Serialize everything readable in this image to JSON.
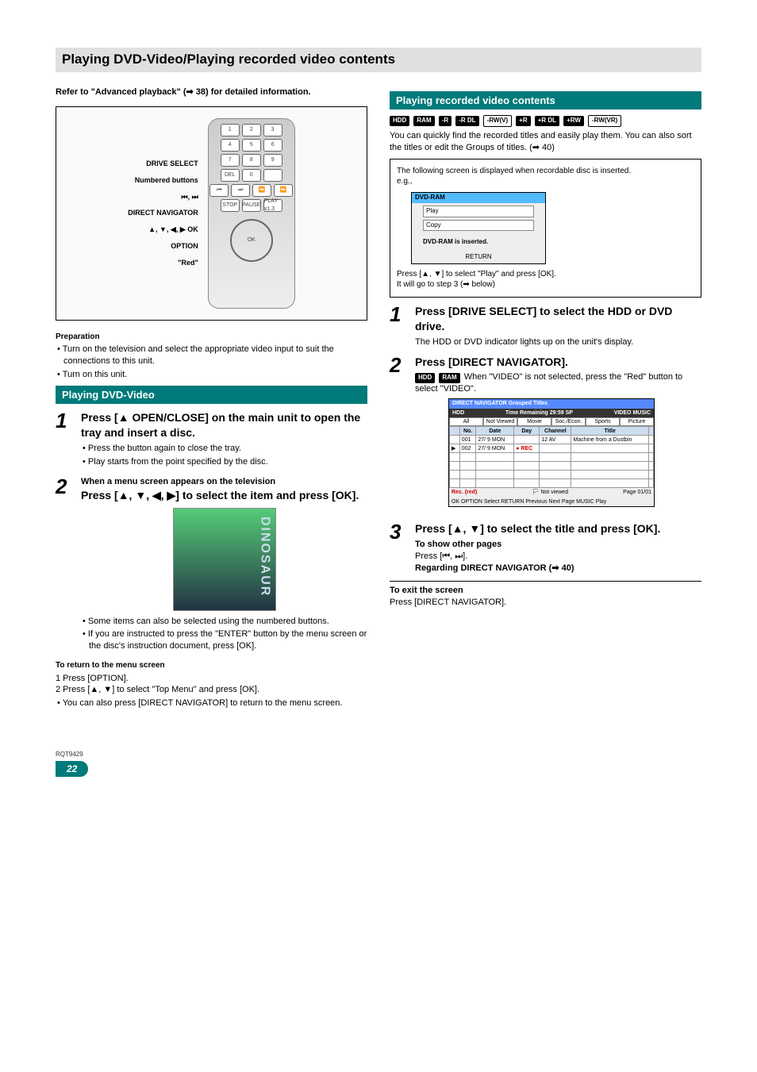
{
  "page_title": "Playing DVD-Video/Playing recorded video contents",
  "ref_line": "Refer to \"Advanced playback\" (➡ 38) for detailed information.",
  "remote": {
    "labels": [
      "DRIVE SELECT",
      "Numbered buttons",
      "⏮, ⏭",
      "DIRECT NAVIGATOR",
      "▲, ▼, ◀, ▶ OK",
      "OPTION",
      "\"Red\""
    ],
    "keys_r1": [
      "1",
      "2",
      "3"
    ],
    "keys_r2": [
      "4",
      "5",
      "6"
    ],
    "keys_r3": [
      "7",
      "8",
      "9"
    ],
    "keys_r4": [
      "DEL",
      "0",
      ""
    ],
    "trans": [
      "⏮",
      "⏭",
      "⏪",
      "⏩"
    ],
    "trans2": [
      "STOP",
      "PAUSE",
      "PLAY x1.3"
    ]
  },
  "preparation": {
    "head": "Preparation",
    "b1": "• Turn on the television and select the appropriate video input to suit the connections to this unit.",
    "b2": "• Turn on this unit."
  },
  "dvdvideo": {
    "head": "Playing DVD-Video",
    "step1": {
      "title": "Press [▲ OPEN/CLOSE] on the main unit to open the tray and insert a disc.",
      "b1": "• Press the button again to close the tray.",
      "b2": "• Play starts from the point specified by the disc."
    },
    "step2": {
      "pre": "When a menu screen appears on the television",
      "title": "Press [▲, ▼, ◀, ▶] to select the item and press [OK].",
      "b1": "• Some items can also be selected using the numbered buttons.",
      "b2": "• If you are instructed to press the \"ENTER\" button by the menu screen or the disc's instruction document, press [OK]."
    },
    "return": {
      "head": "To return to the menu screen",
      "l1": "1   Press [OPTION].",
      "l2": "2   Press [▲, ▼] to select \"Top Menu\" and press [OK].",
      "l3": "• You can also press [DIRECT NAVIGATOR] to return to the menu screen."
    }
  },
  "recorded": {
    "head": "Playing recorded video contents",
    "badges": [
      "HDD",
      "RAM",
      "-R",
      "-R DL",
      "-RW(V)",
      "+R",
      "+R DL",
      "+RW",
      "-RW(VR)"
    ],
    "intro": "You can quickly find the recorded titles and easily play them. You can also sort the titles or edit the Groups of titles. (➡ 40)",
    "inset": {
      "l1": "The following screen is displayed when recordable disc is inserted.",
      "eg": "e.g.,",
      "panel_hdr": "DVD-RAM",
      "panel_play": "Play",
      "panel_copy": "Copy",
      "panel_msg": "DVD-RAM is inserted.",
      "panel_return": "RETURN",
      "l2": "Press [▲, ▼] to select \"Play\" and press [OK].",
      "l3": "It will go to step 3 (➡ below)"
    },
    "step1": {
      "title": "Press [DRIVE SELECT] to select the HDD or DVD drive.",
      "sub": "The HDD or DVD indicator lights up on the unit's display."
    },
    "step2": {
      "title": "Press [DIRECT NAVIGATOR].",
      "badges": [
        "HDD",
        "RAM"
      ],
      "sub": " When \"VIDEO\" is not selected, press the \"Red\" button to select \"VIDEO\"."
    },
    "nav": {
      "title_l": "DIRECT NAVIGATOR  Grouped Titles",
      "hdd": "HDD",
      "time": "Time Remaining  29:59 SP",
      "tabs": [
        "All",
        "Not Viewed",
        "Movie",
        "Soc./Econ.",
        "Sports"
      ],
      "tabs_r": [
        "VIDEO",
        "MUSIC",
        "Picture"
      ],
      "cols": [
        "",
        "No.",
        "Date",
        "Day",
        "Channel",
        "Title",
        ""
      ],
      "row1": [
        "",
        "001",
        "27/ 9 MON",
        "",
        "12 AV",
        "Machine from a Dustbin",
        ""
      ],
      "row_rec": [
        "▶",
        "002",
        "27/ 9 MON",
        "",
        "",
        "",
        ""
      ],
      "rec_icon": "Rec. (red)",
      "rec_text": "● REC",
      "notview": "🏳 Not viewed",
      "page": "Page 01/01",
      "foot": "OK   OPTION   Select   RETURN   Previous   Next   Page   MUSIC   Play"
    },
    "step3": {
      "title": "Press [▲, ▼] to select the title and press [OK].",
      "b1": "To show other pages",
      "b2": "Press [⏮, ⏭].",
      "b3": "Regarding DIRECT NAVIGATOR (➡ 40)"
    },
    "exit": {
      "head": "To exit the screen",
      "line": "Press [DIRECT NAVIGATOR]."
    }
  },
  "footer": {
    "rqt": "RQT9429",
    "page": "22"
  }
}
